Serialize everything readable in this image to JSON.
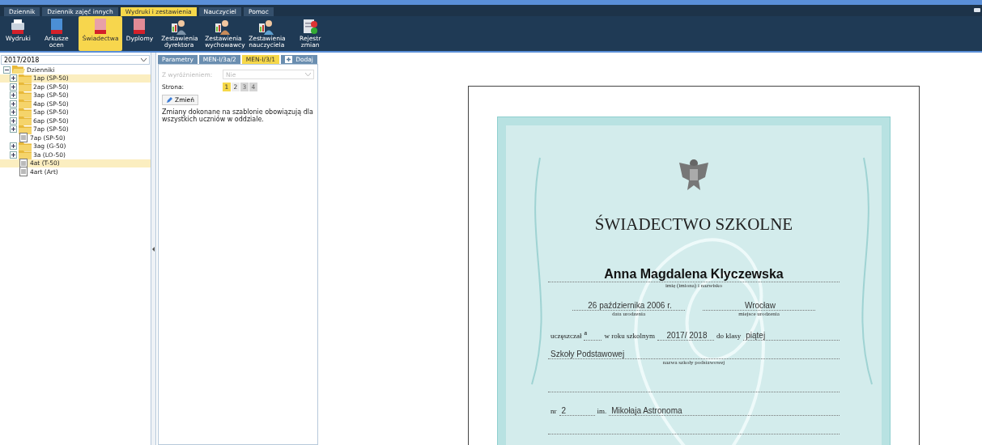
{
  "menu": [
    {
      "label": "Dziennik",
      "selected": false
    },
    {
      "label": "Dziennik zajęć innych",
      "selected": false
    },
    {
      "label": "Wydruki i zestawienia",
      "selected": true
    },
    {
      "label": "Nauczyciel",
      "selected": false
    },
    {
      "label": "Pomoc",
      "selected": false
    }
  ],
  "toolbar": [
    {
      "kind": "printer",
      "label": "Wydruki",
      "selected": false
    },
    {
      "kind": "grades",
      "label": "Arkusze ocen",
      "selected": false
    },
    {
      "kind": "certificate",
      "label": "Świadectwa",
      "selected": true
    },
    {
      "kind": "diploma",
      "label": "Dyplomy",
      "selected": false
    },
    {
      "kind": "man",
      "label": "Zestawienia dyrektora",
      "selected": false
    },
    {
      "kind": "woman",
      "label": "Zestawienia wychowawcy",
      "selected": false
    },
    {
      "kind": "person",
      "label": "Zestawienia nauczyciela",
      "selected": false
    },
    {
      "kind": "register",
      "label": "Rejestr zmian",
      "selected": false
    }
  ],
  "year_select": {
    "value": "2017/2018"
  },
  "tree": {
    "label": "Dzienniki",
    "expanded": true,
    "children": [
      {
        "label": "1ap (SP-50)",
        "kind": "folder",
        "selected": true
      },
      {
        "label": "2ap (SP-50)",
        "kind": "folder",
        "selected": false
      },
      {
        "label": "3ap (SP-50)",
        "kind": "folder",
        "selected": false
      },
      {
        "label": "4ap (SP-50)",
        "kind": "folder",
        "selected": false
      },
      {
        "label": "5ap (SP-50)",
        "kind": "folder",
        "selected": false
      },
      {
        "label": "6ap (SP-50)",
        "kind": "folder",
        "selected": false
      },
      {
        "label": "7ap (SP-50)",
        "kind": "folder",
        "selected": false
      },
      {
        "label": "7ap (SP-50)",
        "kind": "journal",
        "selected": false
      },
      {
        "label": "3ag (G-50)",
        "kind": "folder",
        "selected": false
      },
      {
        "label": "3a (LO-50)",
        "kind": "folder",
        "selected": false
      },
      {
        "label": "4at (T-50)",
        "kind": "journal",
        "selected": true
      },
      {
        "label": "4art (Art)",
        "kind": "journal",
        "selected": false
      }
    ]
  },
  "tabs": [
    {
      "label": "Parametry",
      "kind": "tab",
      "selected": false
    },
    {
      "label": "MEN-I/3a/2",
      "kind": "tab",
      "selected": false
    },
    {
      "label": "MEN-I/3/1",
      "kind": "tab",
      "selected": true
    },
    {
      "label": "Dodaj",
      "kind": "add",
      "selected": false
    }
  ],
  "params": {
    "distinction": {
      "label": "Z wyróżnieniem:",
      "value": "Nie",
      "disabled": true
    },
    "page_label": "Strona:",
    "pages": [
      {
        "label": "1",
        "selected": true,
        "disabled": false
      },
      {
        "label": "2",
        "selected": false,
        "disabled": false
      },
      {
        "label": "3",
        "selected": false,
        "disabled": true
      },
      {
        "label": "4",
        "selected": false,
        "disabled": true
      }
    ],
    "change_button": "Zmień",
    "note": "Zmiany dokonane na szablonie obowiązują dla wszystkich uczniów w oddziale."
  },
  "certificate": {
    "title": "ŚWIADECTWO SZKOLNE",
    "name": "Anna Magdalena Klyczewska",
    "name_caption": "imię (imiona) i nazwisko",
    "birth_date": "26 października 2006 r.",
    "birth_date_caption": "data urodzenia",
    "birth_place": "Wrocław",
    "birth_place_caption": "miejsce urodzenia",
    "attended_label": "uczęszczał",
    "attended_suffix": "a",
    "year_label": "w roku szkolnym",
    "year": "2017/ 2018",
    "class_label": "do klasy",
    "class": "piątej",
    "school": "Szkoły Podstawowej",
    "school_caption": "nazwa szkoły podstawowej",
    "number_label": "nr",
    "number": "2",
    "patron_label": "im.",
    "patron": "Mikołaja Astronoma"
  }
}
